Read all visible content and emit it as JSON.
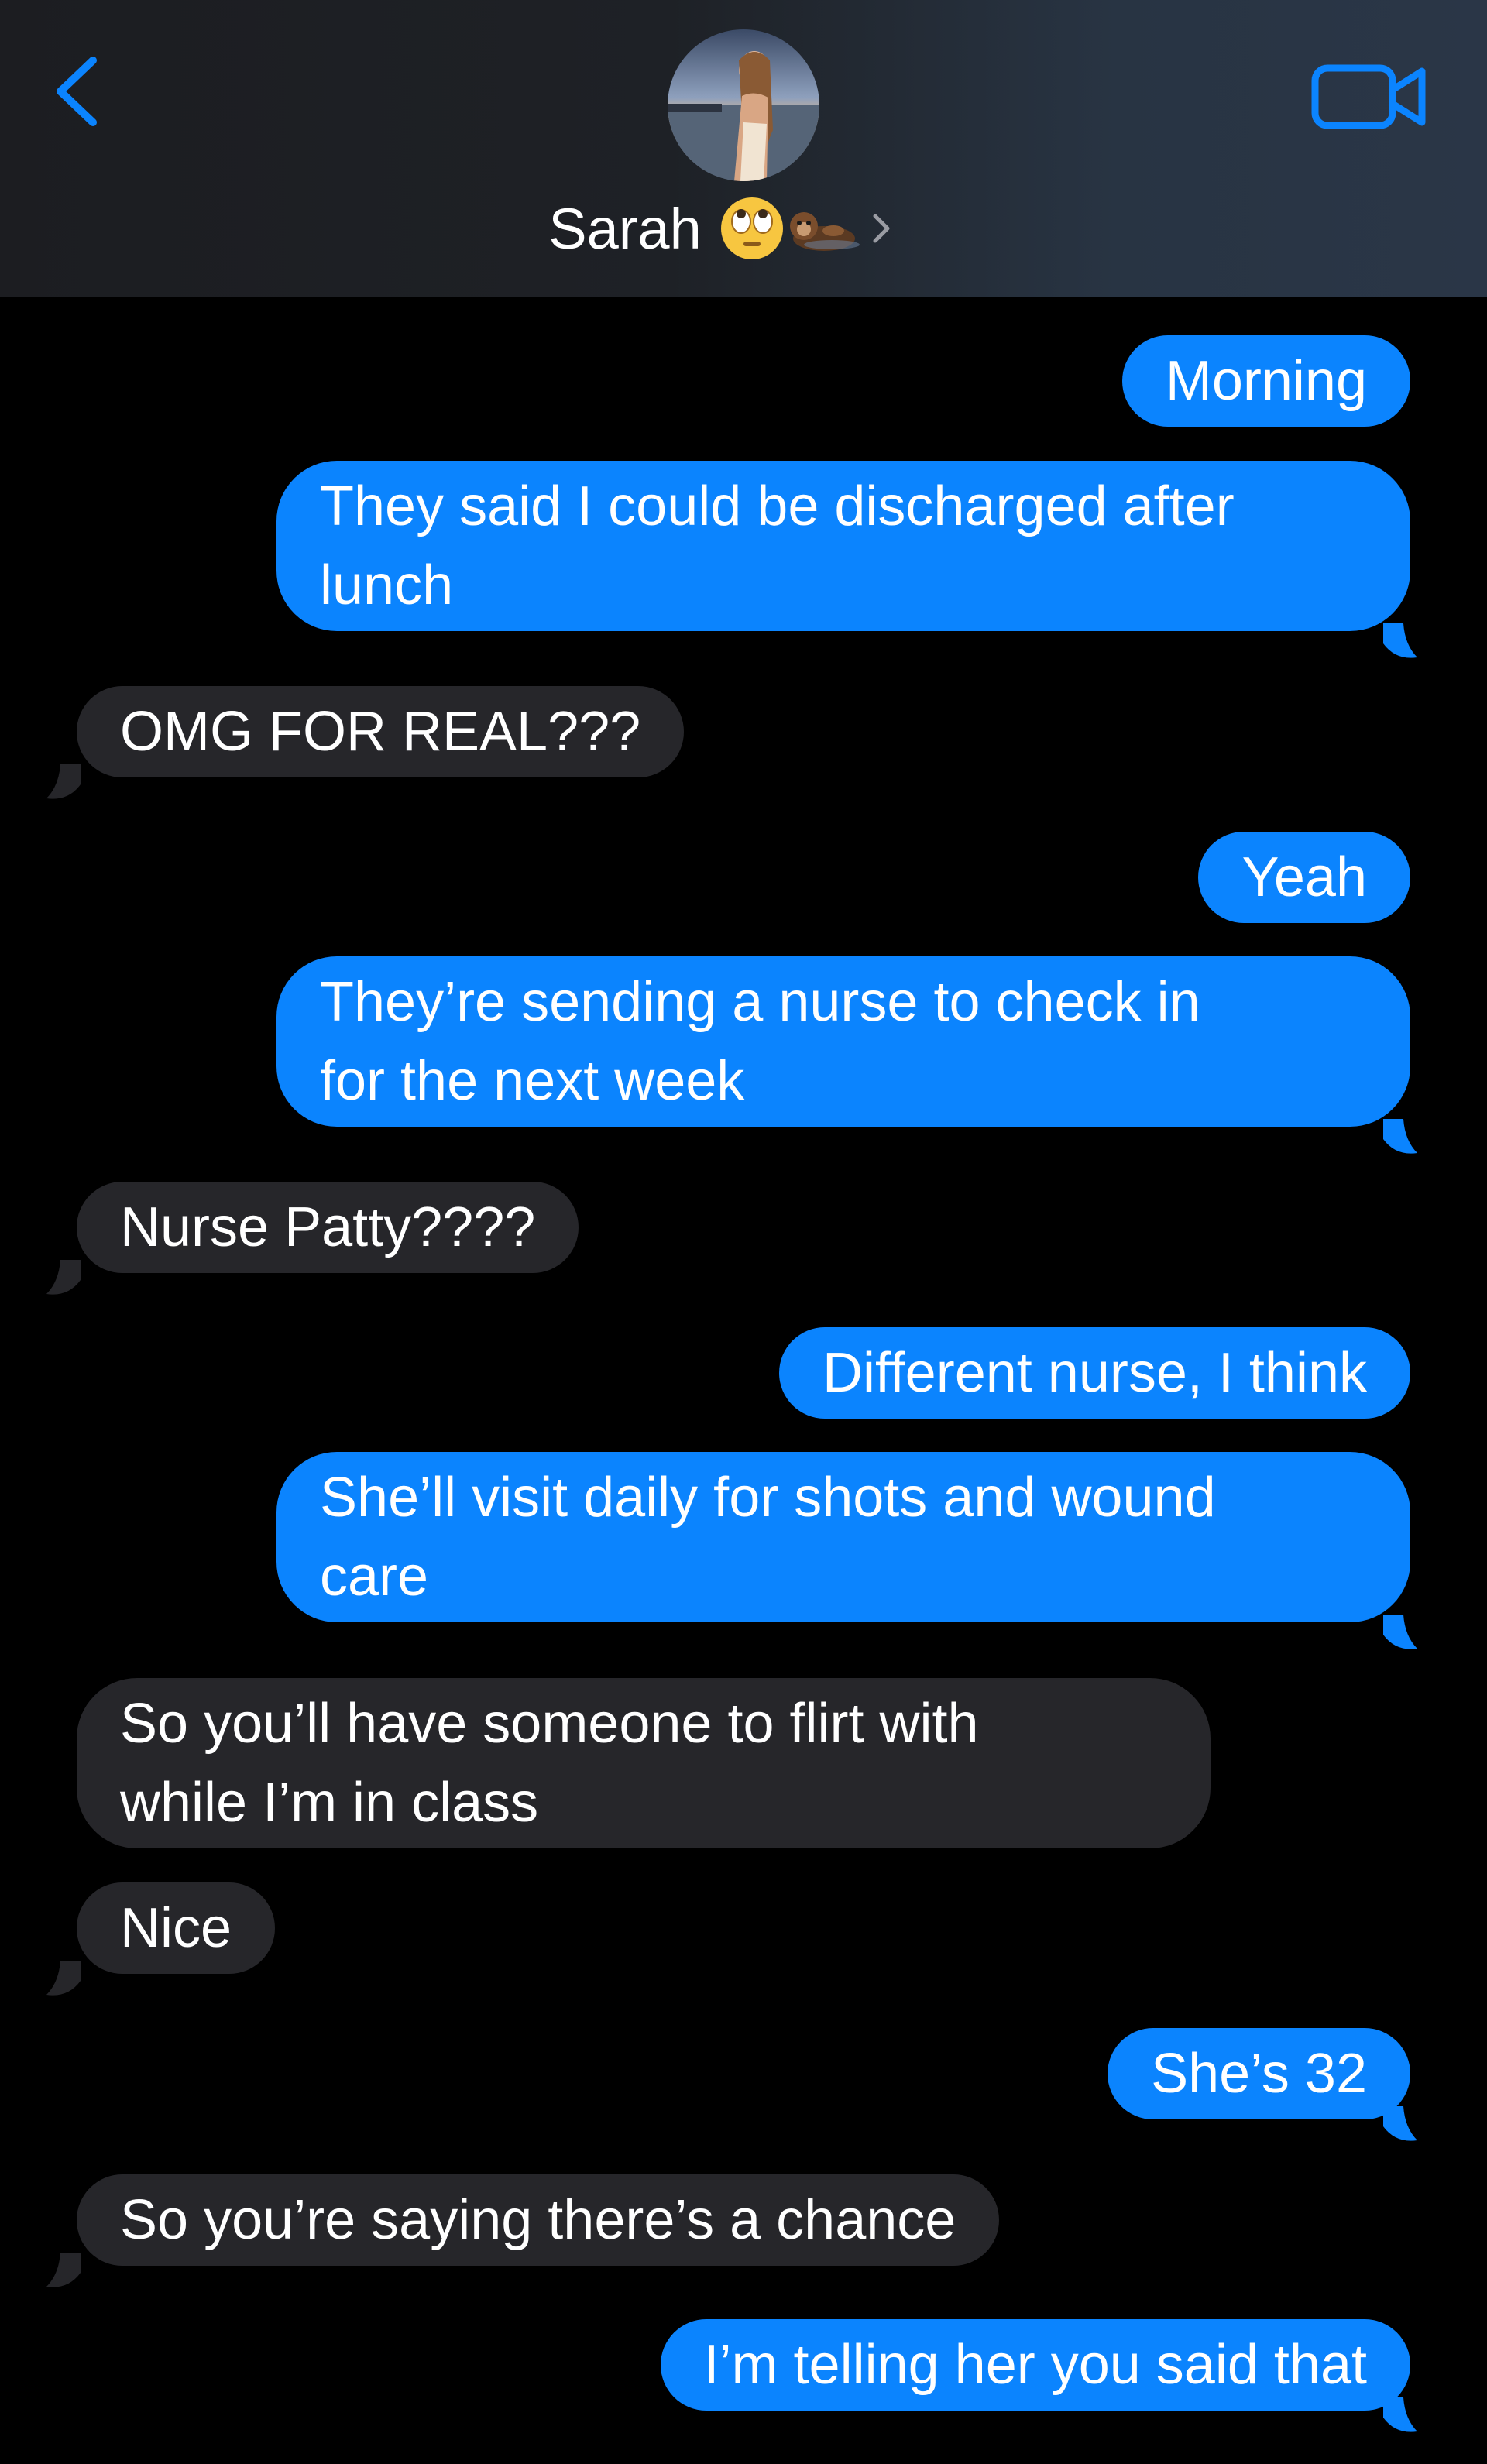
{
  "header": {
    "contact_name": "Sarah",
    "back_icon": "chevron-left-icon",
    "video_icon": "video-camera-icon",
    "name_emojis": [
      "face-with-rolling-eyes",
      "otter"
    ]
  },
  "colors": {
    "sent_bubble": "#0b84fe",
    "received_bubble": "#26262a",
    "accent": "#0b84fe",
    "background": "#000000"
  },
  "messages": [
    {
      "sender": "me",
      "lines": [
        "Morning"
      ]
    },
    {
      "sender": "me",
      "lines": [
        "They said I could be discharged after",
        "lunch"
      ]
    },
    {
      "sender": "them",
      "lines": [
        "OMG FOR REAL???"
      ]
    },
    {
      "sender": "me",
      "lines": [
        "Yeah"
      ]
    },
    {
      "sender": "me",
      "lines": [
        "They’re sending a nurse to check in",
        "for the next week"
      ]
    },
    {
      "sender": "them",
      "lines": [
        "Nurse Patty????"
      ]
    },
    {
      "sender": "me",
      "lines": [
        "Different nurse, I think"
      ]
    },
    {
      "sender": "me",
      "lines": [
        "She’ll visit daily for shots and wound",
        "care"
      ]
    },
    {
      "sender": "them",
      "lines": [
        "So you’ll have someone to flirt with",
        "while I’m in class"
      ]
    },
    {
      "sender": "them",
      "lines": [
        "Nice"
      ]
    },
    {
      "sender": "me",
      "lines": [
        "She’s 32"
      ]
    },
    {
      "sender": "them",
      "lines": [
        "So you’re saying there’s a chance"
      ]
    },
    {
      "sender": "me",
      "lines": [
        "I’m telling her you said that"
      ]
    }
  ]
}
